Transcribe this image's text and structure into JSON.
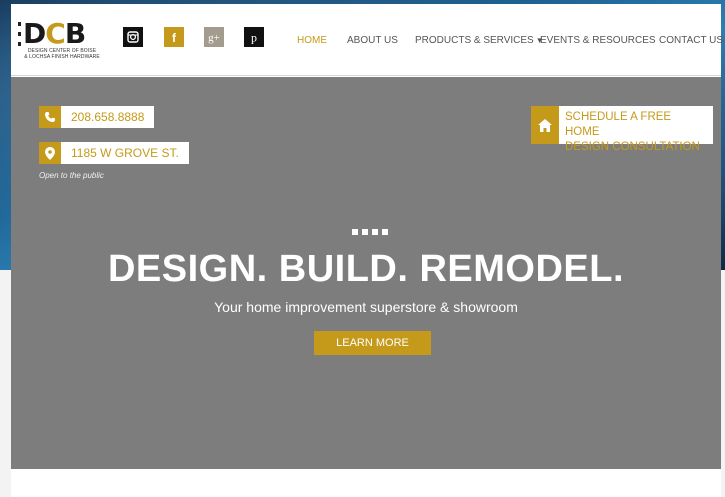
{
  "logo": {
    "letters": [
      "D",
      "C",
      "B"
    ],
    "subtitle_line1": "DESIGN CENTER OF BOISE",
    "subtitle_line2": "& LOCHSA FINISH HARDWARE"
  },
  "social": [
    {
      "name": "instagram-icon",
      "color": "#111111"
    },
    {
      "name": "facebook-icon",
      "color": "#c59a1a",
      "glyph": "f"
    },
    {
      "name": "google-plus-icon",
      "color": "#a39b8e",
      "glyph": "g+"
    },
    {
      "name": "pinterest-icon",
      "color": "#111111",
      "glyph": "p"
    }
  ],
  "nav": {
    "home": "HOME",
    "about": "ABOUT US",
    "products": "PRODUCTS & SERVICES",
    "events": "EVENTS & RESOURCES",
    "contact": "CONTACT US"
  },
  "hero": {
    "phone": "208.658.8888",
    "address": "1185 W GROVE ST.",
    "open_note": "Open to the public",
    "consult_line1": "SCHEDULE A FREE HOME",
    "consult_line2": "DESIGN CONSULTATION",
    "headline": "DESIGN. BUILD. REMODEL.",
    "tagline": "Your home improvement superstore & showroom",
    "cta": "LEARN MORE"
  },
  "colors": {
    "accent": "#c59a1a",
    "hero_bg": "#7d7d7d",
    "nav_text": "#555555"
  }
}
